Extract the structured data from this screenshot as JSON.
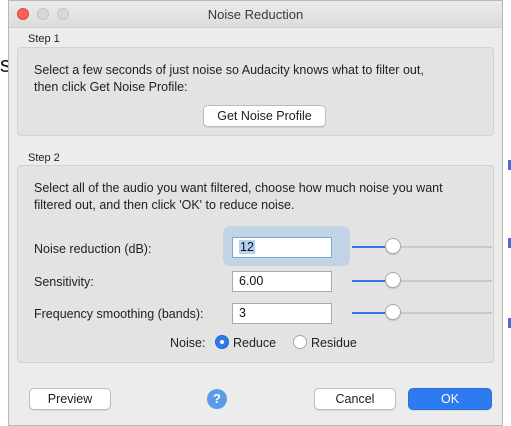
{
  "window": {
    "title": "Noise Reduction"
  },
  "background": {
    "partial_text": "s"
  },
  "step1": {
    "label": "Step 1",
    "desc_line1": "Select a few seconds of just noise so Audacity knows what to filter out,",
    "desc_line2": "then click Get Noise Profile:",
    "get_profile_label": "Get Noise Profile"
  },
  "step2": {
    "label": "Step 2",
    "desc_line1": "Select all of the audio you want filtered, choose how much noise you want",
    "desc_line2": "filtered out, and then click 'OK' to reduce noise.",
    "noise_reduction": {
      "label": "Noise reduction (dB):",
      "value": "12",
      "slider_fraction": 0.27
    },
    "sensitivity": {
      "label": "Sensitivity:",
      "value": "6.00",
      "slider_fraction": 0.27
    },
    "frequency_smoothing": {
      "label": "Frequency smoothing (bands):",
      "value": "3",
      "slider_fraction": 0.27
    },
    "noise": {
      "label": "Noise:",
      "options": [
        "Reduce",
        "Residue"
      ],
      "selected": "Reduce"
    }
  },
  "buttons": {
    "preview": "Preview",
    "help": "?",
    "cancel": "Cancel",
    "ok": "OK"
  },
  "colors": {
    "accent": "#2d79e6",
    "close": "#fe5f57",
    "ok_button": "#2d7bf0",
    "edge_mark": "#4a6fd6"
  }
}
